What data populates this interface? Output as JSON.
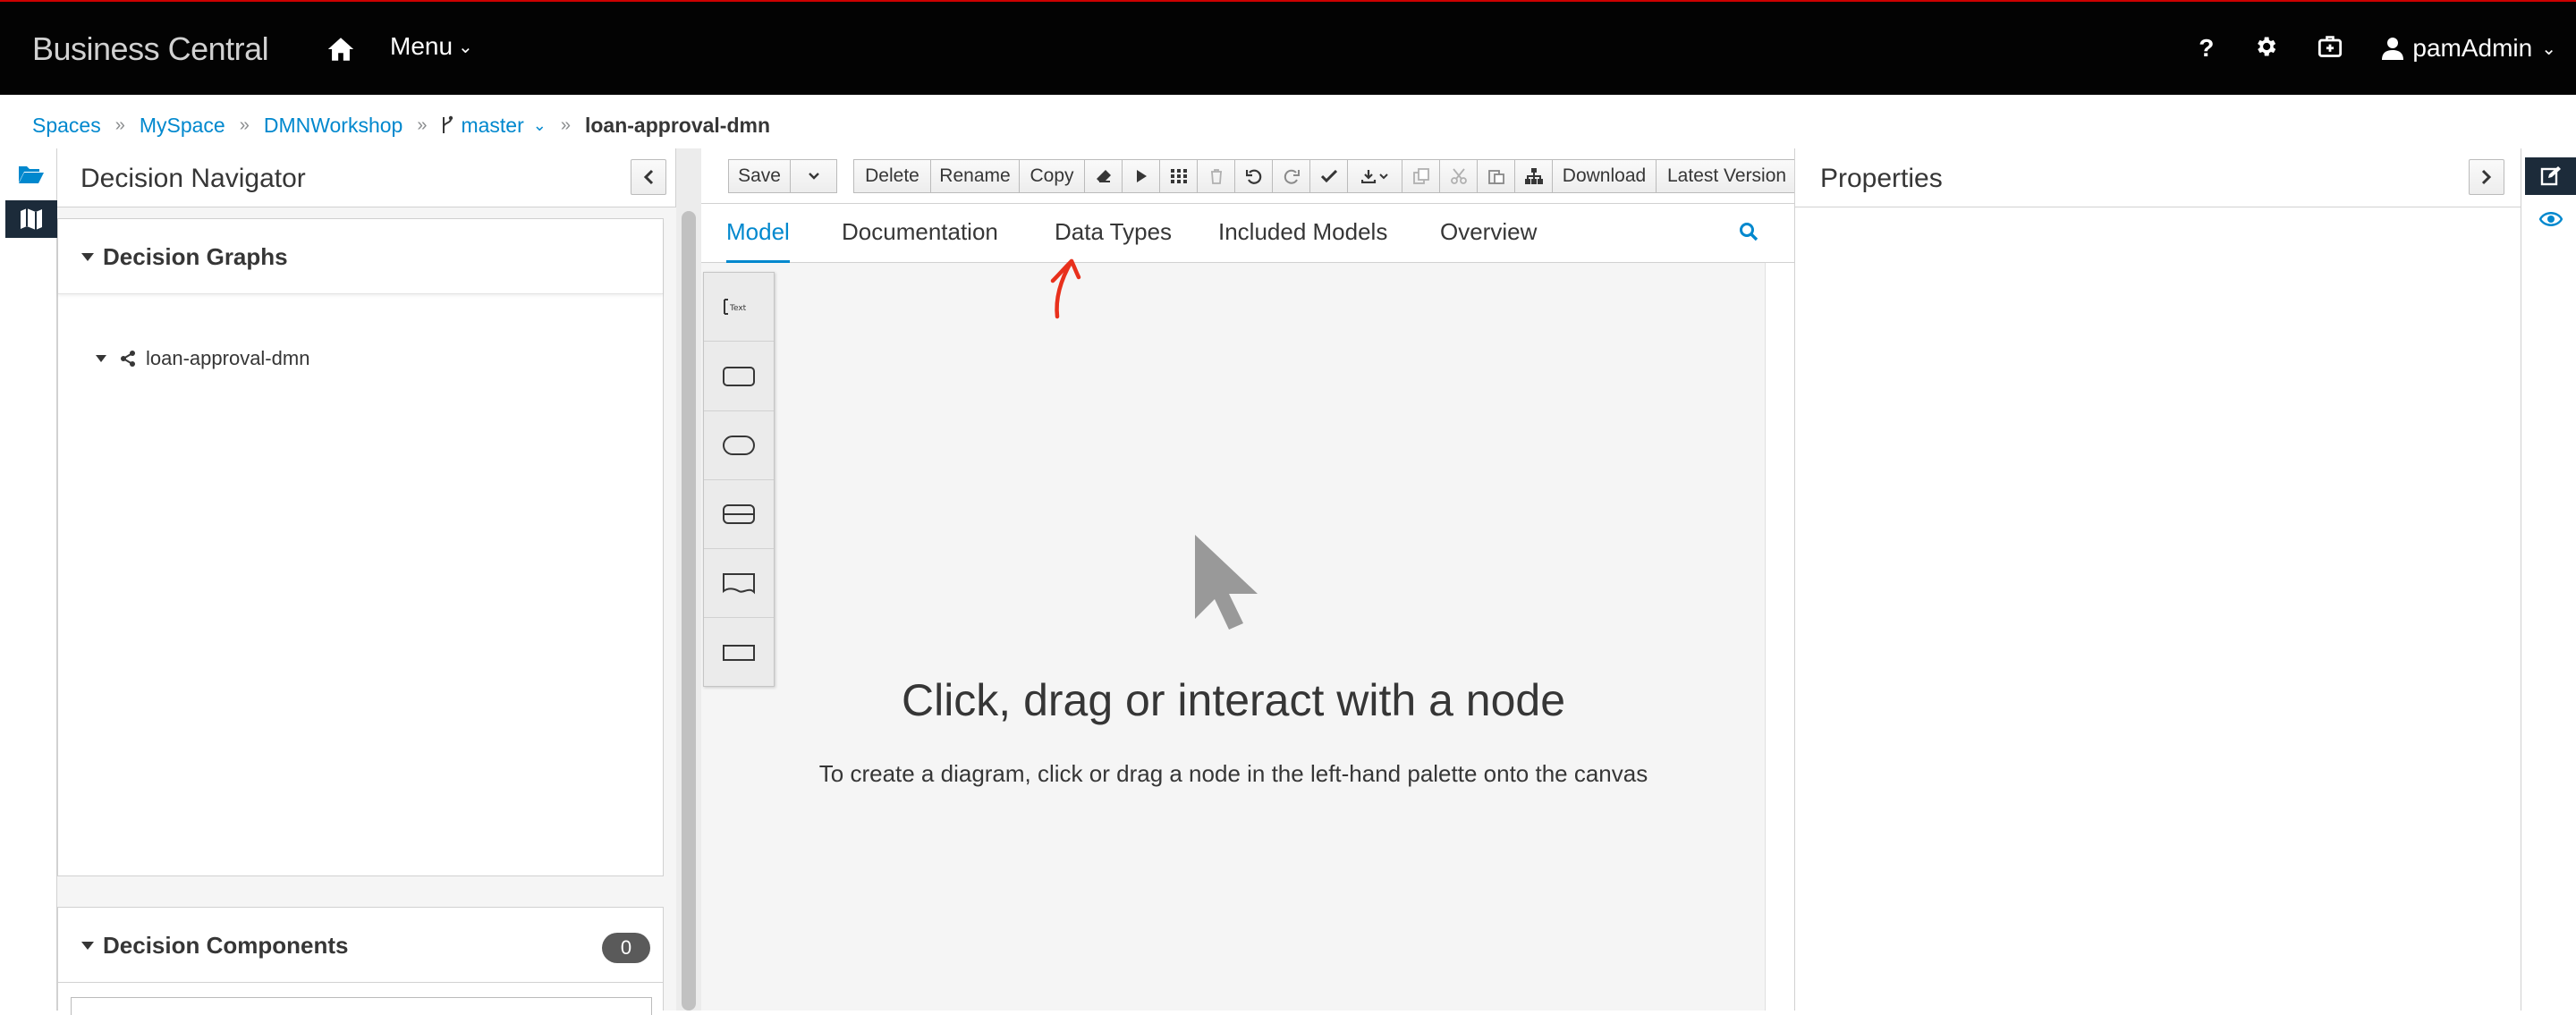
{
  "app": {
    "brand": "Business Central",
    "menu_label": "Menu",
    "help_label": "?",
    "user_name": "pamAdmin"
  },
  "breadcrumb": {
    "spaces": "Spaces",
    "space": "MySpace",
    "project": "DMNWorkshop",
    "branch": "master",
    "asset": "loan-approval-dmn"
  },
  "navigator": {
    "title": "Decision Navigator",
    "graphs_title": "Decision Graphs",
    "graph_item": "loan-approval-dmn",
    "components_title": "Decision Components",
    "components_count": "0"
  },
  "toolbar": {
    "save": "Save",
    "delete": "Delete",
    "rename": "Rename",
    "copy": "Copy",
    "download": "Download",
    "latest_version": "Latest Version"
  },
  "tabs": [
    "Model",
    "Documentation",
    "Data Types",
    "Included Models",
    "Overview"
  ],
  "active_tab": "Model",
  "palette": [
    "dmn-decision-service-icon",
    "dmn-input-data-icon",
    "dmn-decision-icon",
    "dmn-bkm-icon",
    "dmn-knowledge-source-icon",
    "dmn-text-annotation-icon"
  ],
  "canvas": {
    "empty_title": "Click, drag or interact with a node",
    "empty_subtitle": "To create a diagram, click or drag a node in the left-hand palette onto the canvas"
  },
  "properties": {
    "title": "Properties"
  },
  "colors": {
    "accent": "#0088ce",
    "topbar": "#030303",
    "annotation": "#e8301c"
  }
}
